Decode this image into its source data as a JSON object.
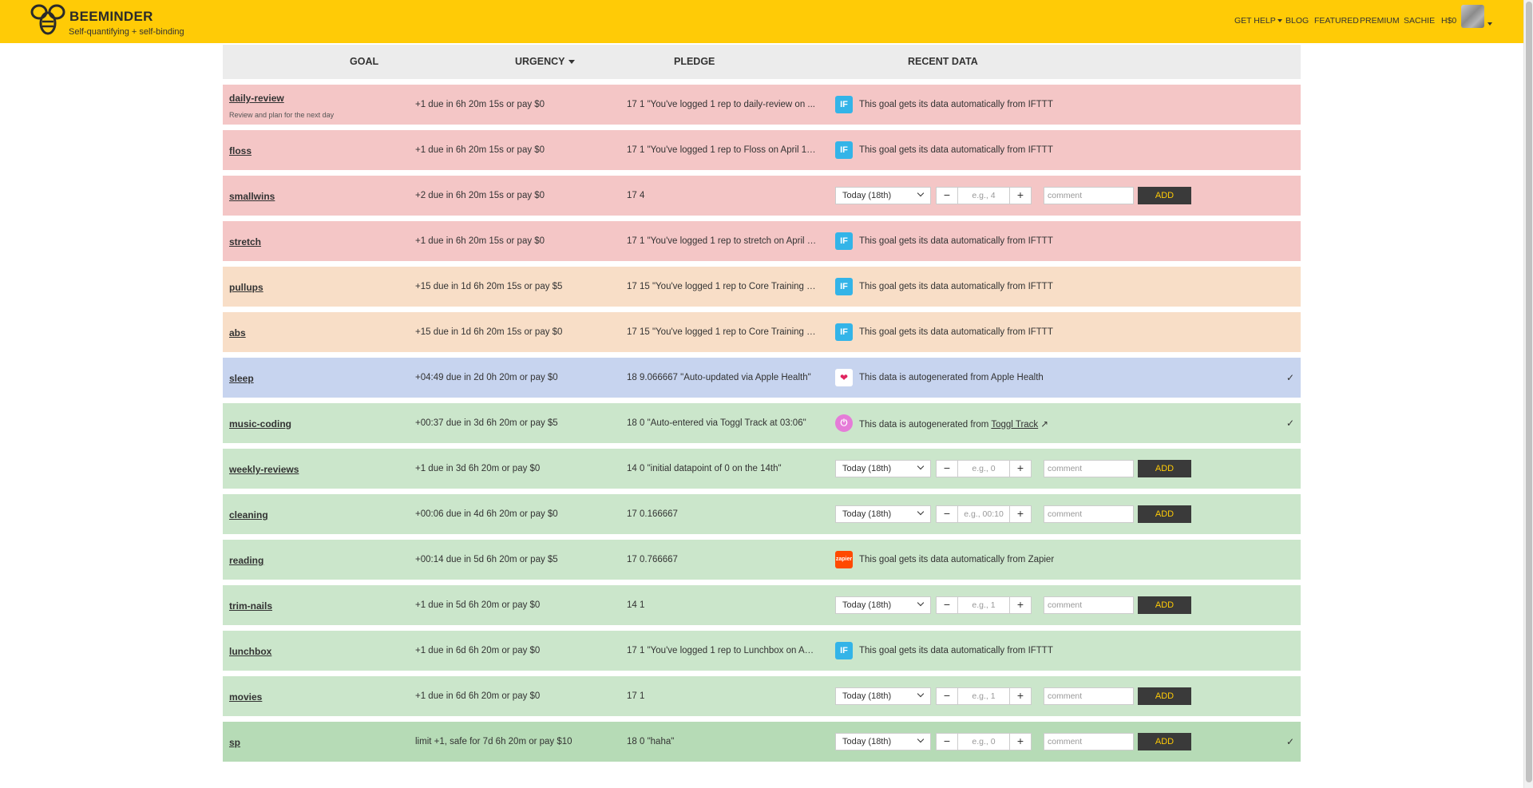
{
  "header": {
    "brand": "BEEMINDER",
    "tagline": "Self-quantifying + self-binding",
    "nav": {
      "get_help": "GET HELP",
      "blog": "BLOG",
      "featured": "FEATURED",
      "premium": "PREMIUM",
      "user": "SACHIE",
      "balance": "H$0"
    },
    "brand_color": "#ffcb06"
  },
  "table": {
    "headers": {
      "goal": "GOAL",
      "urgency": "URGENCY",
      "pledge": "PLEDGE",
      "recent": "RECENT DATA"
    }
  },
  "form": {
    "date_option": "Today (18th)",
    "minus": "−",
    "plus": "+",
    "comment_placeholder": "comment",
    "add_label": "ADD"
  },
  "sources": {
    "ifttt_icon": "IF",
    "ifttt_text": "This goal gets its data automatically from IFTTT",
    "apple_icon": "❤",
    "apple_text": "This data is autogenerated from Apple Health",
    "toggl_icon": "⏻",
    "toggl_text": "This data is autogenerated from",
    "toggl_link": "Toggl Track",
    "zapier_icon": "zapier",
    "zapier_text": "This goal gets its data automatically from Zapier"
  },
  "check_mark": "✓",
  "goals": [
    {
      "name": "daily-review",
      "desc": "Review and plan for the next day",
      "urgency": "+1 due in 6h 20m 15s or pay $0",
      "pledge": "17 1 \"You've logged 1 rep to daily-review on ...",
      "color": "red",
      "source": "ifttt"
    },
    {
      "name": "floss",
      "urgency": "+1 due in 6h 20m 15s or pay $0",
      "pledge": "17 1 \"You've logged 1 rep to Floss on April 17,...",
      "color": "red",
      "source": "ifttt"
    },
    {
      "name": "smallwins",
      "urgency": "+2 due in 6h 20m 15s or pay $0",
      "pledge": "17 4",
      "color": "red",
      "source": "form",
      "placeholder": "e.g., 4"
    },
    {
      "name": "stretch",
      "urgency": "+1 due in 6h 20m 15s or pay $0",
      "pledge": "17 1 \"You've logged 1 rep to stretch on April 1...",
      "color": "red",
      "source": "ifttt"
    },
    {
      "name": "pullups",
      "urgency": "+15 due in 1d 6h 20m 15s or pay $5",
      "pledge": "17 15 \"You've logged 1 rep to Core Training o...",
      "color": "orange",
      "source": "ifttt"
    },
    {
      "name": "abs",
      "urgency": "+15 due in 1d 6h 20m 15s or pay $0",
      "pledge": "17 15 \"You've logged 1 rep to Core Training o...",
      "color": "orange",
      "source": "ifttt"
    },
    {
      "name": "sleep",
      "urgency": "+04:49 due in 2d 0h 20m or pay $0",
      "pledge": "18 9.066667 \"Auto-updated via Apple Health\"",
      "color": "blue",
      "source": "apple",
      "check": true
    },
    {
      "name": "music-coding",
      "urgency": "+00:37 due in 3d 6h 20m or pay $5",
      "pledge": "18 0 \"Auto-entered via Toggl Track at 03:06\"",
      "color": "green",
      "source": "toggl",
      "check": true
    },
    {
      "name": "weekly-reviews",
      "urgency": "+1 due in 3d 6h 20m or pay $0",
      "pledge": "14 0 \"initial datapoint of 0 on the 14th\"",
      "color": "green",
      "source": "form",
      "placeholder": "e.g., 0"
    },
    {
      "name": "cleaning",
      "urgency": "+00:06 due in 4d 6h 20m or pay $0",
      "pledge": "17 0.166667",
      "color": "green",
      "source": "form",
      "placeholder": "e.g., 00:10"
    },
    {
      "name": "reading",
      "urgency": "+00:14 due in 5d 6h 20m or pay $5",
      "pledge": "17 0.766667",
      "color": "green",
      "source": "zapier"
    },
    {
      "name": "trim-nails",
      "urgency": "+1 due in 5d 6h 20m or pay $0",
      "pledge": "14 1",
      "color": "green",
      "source": "form",
      "placeholder": "e.g., 1"
    },
    {
      "name": "lunchbox",
      "urgency": "+1 due in 6d 6h 20m or pay $0",
      "pledge": "17 1 \"You've logged 1 rep to Lunchbox on Apr...",
      "color": "green",
      "source": "ifttt"
    },
    {
      "name": "movies",
      "urgency": "+1 due in 6d 6h 20m or pay $0",
      "pledge": "17 1",
      "color": "green",
      "source": "form",
      "placeholder": "e.g., 1"
    },
    {
      "name": "sp",
      "urgency": "limit +1, safe for 7d 6h 20m or pay $10",
      "pledge": "18 0 \"haha\"",
      "color": "darkgreen",
      "source": "form",
      "placeholder": "e.g., 0",
      "check": true
    }
  ]
}
